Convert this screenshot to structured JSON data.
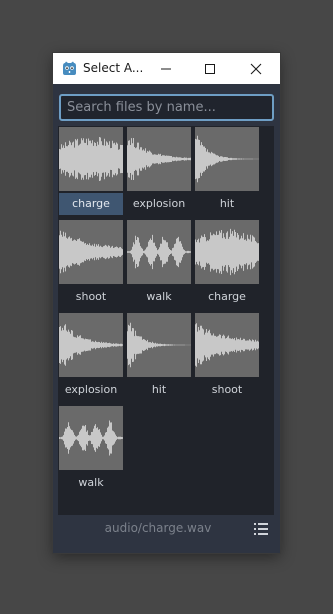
{
  "window": {
    "title": "Select A...",
    "app_icon": "godot-icon",
    "controls": [
      "minimize-icon",
      "maximize-icon",
      "close-icon"
    ]
  },
  "search": {
    "value": "",
    "placeholder": "Search files by name..."
  },
  "files": [
    {
      "label": "charge",
      "selected": true,
      "waveform": "charge"
    },
    {
      "label": "explosion",
      "selected": false,
      "waveform": "explosion"
    },
    {
      "label": "hit",
      "selected": false,
      "waveform": "hit"
    },
    {
      "label": "shoot",
      "selected": false,
      "waveform": "shoot"
    },
    {
      "label": "walk",
      "selected": false,
      "waveform": "walk"
    },
    {
      "label": "charge",
      "selected": false,
      "waveform": "charge"
    },
    {
      "label": "explosion",
      "selected": false,
      "waveform": "explosion"
    },
    {
      "label": "hit",
      "selected": false,
      "waveform": "hit"
    },
    {
      "label": "shoot",
      "selected": false,
      "waveform": "shoot"
    },
    {
      "label": "walk",
      "selected": false,
      "waveform": "walk"
    }
  ],
  "status": {
    "path": "audio/charge.wav",
    "view_toggle_icon": "list-view-icon"
  },
  "colors": {
    "desktop": "#474747",
    "panel": "#2e3441",
    "grid": "#20232a",
    "thumb": "#6a6a6a",
    "wave": "#c8c8c8",
    "selection": "#3f5671",
    "focus": "#6e9ec5"
  }
}
